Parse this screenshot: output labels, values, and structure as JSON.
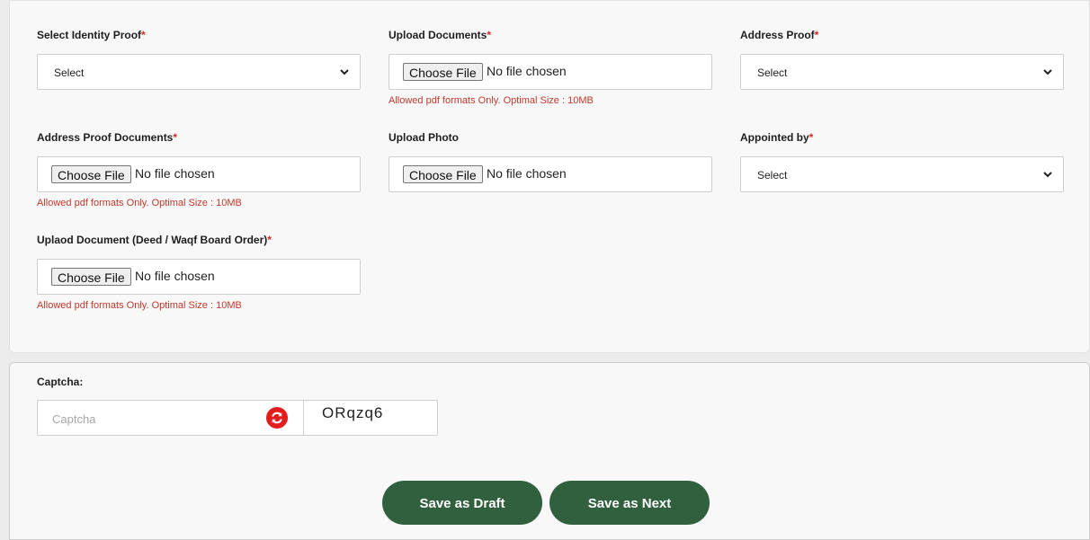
{
  "form": {
    "identity_proof": {
      "label": "Select Identity Proof",
      "required_mark": "*",
      "value": "Select"
    },
    "upload_documents": {
      "label": "Upload Documents",
      "required_mark": "*",
      "button": "Choose File",
      "status": "No file chosen",
      "hint": "Allowed pdf formats Only. Optimal Size : 10MB"
    },
    "address_proof": {
      "label": "Address Proof",
      "required_mark": "*",
      "value": "Select"
    },
    "address_proof_documents": {
      "label": "Address Proof Documents",
      "required_mark": "*",
      "button": "Choose File",
      "status": "No file chosen",
      "hint": "Allowed pdf formats Only. Optimal Size : 10MB"
    },
    "upload_photo": {
      "label": "Upload Photo",
      "button": "Choose File",
      "status": "No file chosen"
    },
    "appointed_by": {
      "label": "Appointed by",
      "required_mark": "*",
      "value": "Select"
    },
    "deed_document": {
      "label": "Uplaod Document (Deed / Waqf Board Order)",
      "required_mark": "*",
      "button": "Choose File",
      "status": "No file chosen",
      "hint": "Allowed pdf formats Only. Optimal Size : 10MB"
    }
  },
  "captcha": {
    "label": "Captcha:",
    "placeholder": "Captcha",
    "code": "ORqzq6"
  },
  "actions": {
    "save_draft": "Save as Draft",
    "save_next": "Save as Next"
  },
  "colors": {
    "accent_green": "#30603e",
    "required_red": "#d22b2b",
    "refresh_red": "#e31d1d"
  }
}
